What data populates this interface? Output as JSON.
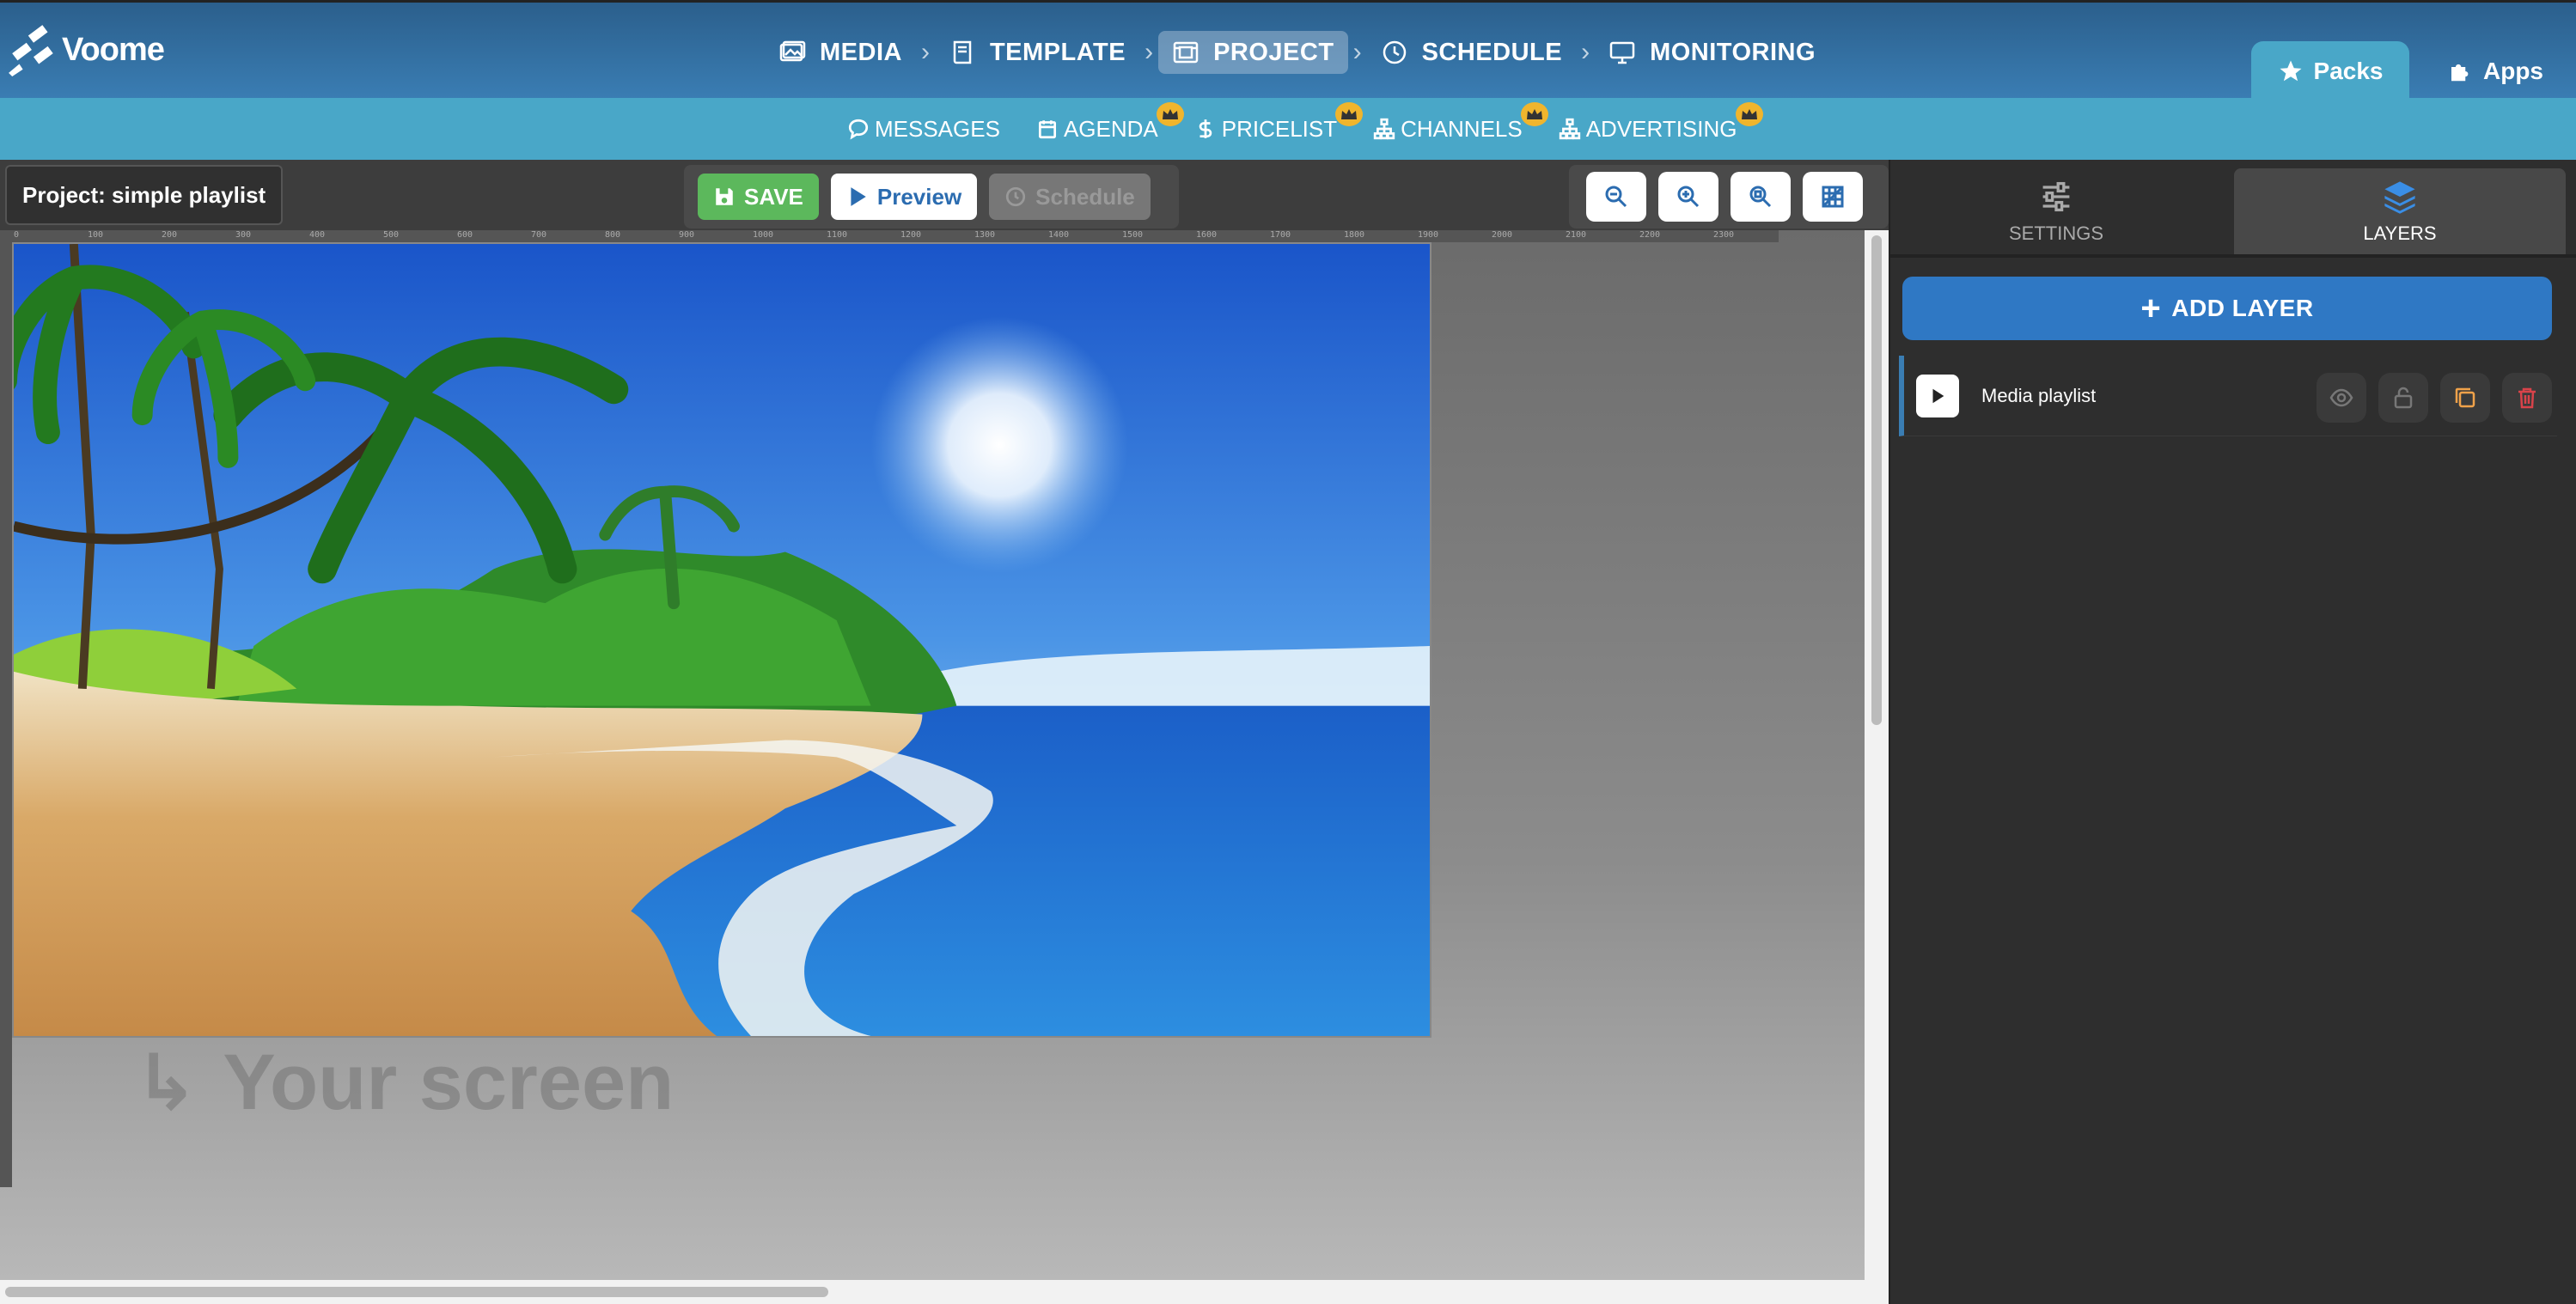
{
  "app": {
    "logo_text": "Voome"
  },
  "main_nav": [
    {
      "label": "MEDIA",
      "icon": "image-icon",
      "active": false
    },
    {
      "label": "TEMPLATE",
      "icon": "book-icon",
      "active": false
    },
    {
      "label": "PROJECT",
      "icon": "project-icon",
      "active": true
    },
    {
      "label": "SCHEDULE",
      "icon": "clock-icon",
      "active": false
    },
    {
      "label": "MONITORING",
      "icon": "monitor-icon",
      "active": false
    }
  ],
  "top_tabs": {
    "packs": "Packs",
    "apps": "Apps"
  },
  "sub_nav": [
    {
      "label": "MESSAGES",
      "icon": "chat-icon",
      "premium": false
    },
    {
      "label": "AGENDA",
      "icon": "calendar-icon",
      "premium": true
    },
    {
      "label": "PRICELIST",
      "icon": "dollar-icon",
      "premium": true
    },
    {
      "label": "CHANNELS",
      "icon": "sitemap-icon",
      "premium": true
    },
    {
      "label": "ADVERTISING",
      "icon": "sitemap-icon",
      "premium": true
    }
  ],
  "editor": {
    "project_label": "Project: simple playlist",
    "save_label": "SAVE",
    "preview_label": "Preview",
    "schedule_label": "Schedule",
    "screen_hint": "Your screen",
    "ruler_ticks": [
      "0",
      "100",
      "200",
      "300",
      "400",
      "500",
      "600",
      "700",
      "800",
      "900",
      "1000",
      "1100",
      "1200",
      "1300",
      "1400",
      "1500",
      "1600",
      "1700",
      "1800",
      "1900",
      "2000",
      "2100",
      "2200",
      "2300"
    ]
  },
  "right_panel": {
    "settings_tab": "SETTINGS",
    "layers_tab": "LAYERS",
    "add_layer_label": "ADD LAYER",
    "layers": [
      {
        "name": "Media playlist"
      }
    ]
  },
  "colors": {
    "header": "#2b5f8c",
    "subbar": "#49a7c8",
    "save": "#5cb85c",
    "add_layer": "#2f78c4",
    "delete": "#d9434a",
    "copy": "#f0a24a",
    "premium_crown": "#f0b52d"
  }
}
